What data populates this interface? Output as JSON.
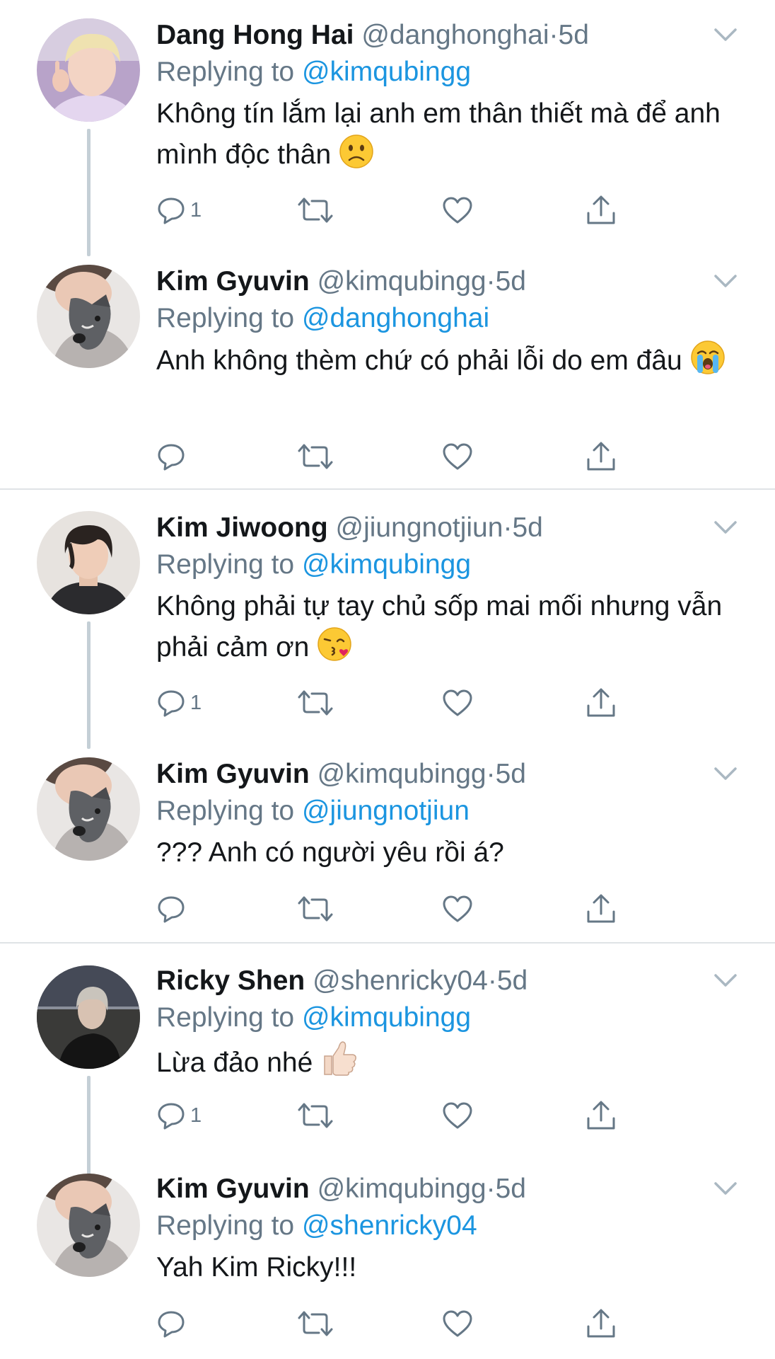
{
  "tweets": [
    {
      "name": "Dang Hong Hai",
      "handle": "@danghonghai",
      "dot": "·",
      "time": "5d",
      "reply_prefix": "Replying to",
      "reply_to": "@kimqubingg",
      "text": "Không tín lắm lại anh em thân thiết mà để anh mình độc thân",
      "emoji": "slightly-frowning-face",
      "reply_count": "1",
      "avatar_icon": "blonde-man-avatar"
    },
    {
      "name": "Kim Gyuvin",
      "handle": "@kimqubingg",
      "dot": "·",
      "time": "5d",
      "reply_prefix": "Replying to",
      "reply_to": "@danghonghai",
      "text": "Anh không thèm chứ có phải lỗi do em đâu",
      "emoji": "loudly-crying-face",
      "reply_count": "",
      "avatar_icon": "man-with-dog-avatar"
    },
    {
      "name": "Kim Jiwoong",
      "handle": "@jiungnotjiun",
      "dot": "·",
      "time": "5d",
      "reply_prefix": "Replying to",
      "reply_to": "@kimqubingg",
      "text": "Không phải tự tay chủ sốp mai mối nhưng vẫn phải cảm ơn",
      "emoji": "face-blowing-kiss",
      "reply_count": "1",
      "avatar_icon": "dark-hair-man-avatar"
    },
    {
      "name": "Kim Gyuvin",
      "handle": "@kimqubingg",
      "dot": "·",
      "time": "5d",
      "reply_prefix": "Replying to",
      "reply_to": "@jiungnotjiun",
      "text": "??? Anh có người yêu rồi á?",
      "emoji": "",
      "reply_count": "",
      "avatar_icon": "man-with-dog-avatar"
    },
    {
      "name": "Ricky Shen",
      "handle": "@shenricky04",
      "dot": "·",
      "time": "5d",
      "reply_prefix": "Replying to",
      "reply_to": "@kimqubingg",
      "text": "Lừa đảo nhé",
      "emoji": "thumbs-up",
      "reply_count": "1",
      "avatar_icon": "night-beach-man-avatar"
    },
    {
      "name": "Kim Gyuvin",
      "handle": "@kimqubingg",
      "dot": "·",
      "time": "5d",
      "reply_prefix": "Replying to",
      "reply_to": "@shenricky04",
      "text": "Yah Kim Ricky!!!",
      "emoji": "",
      "reply_count": "",
      "avatar_icon": "man-with-dog-avatar"
    }
  ],
  "colors": {
    "name": "#14171a",
    "secondary": "#657786",
    "mention": "#1b95e0",
    "thread_line": "#c4cfd6",
    "divider": "#dfe3e6",
    "icon": "#657786"
  }
}
